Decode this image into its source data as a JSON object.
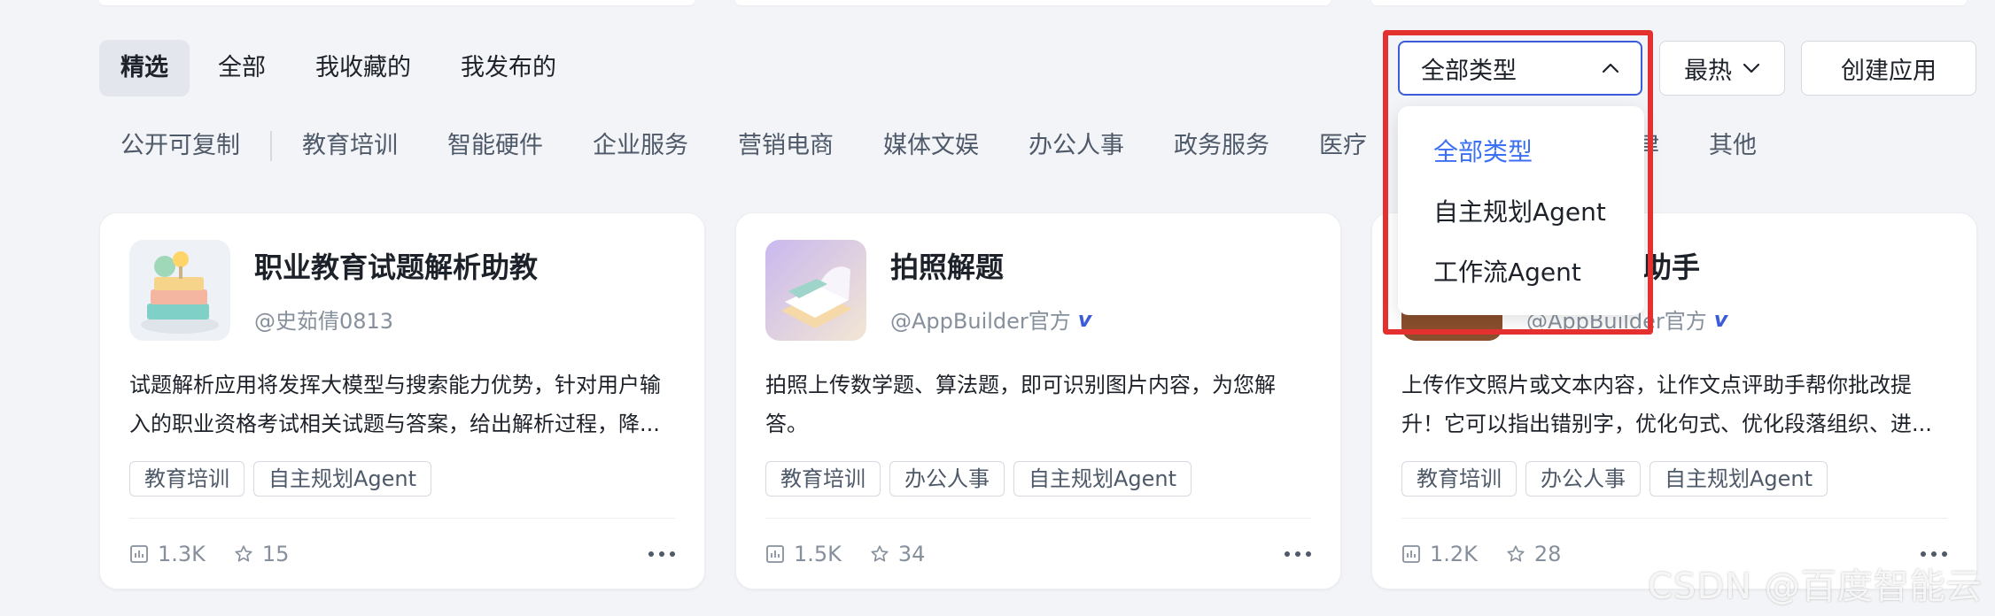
{
  "tabs": [
    {
      "label": "精选",
      "active": true
    },
    {
      "label": "全部"
    },
    {
      "label": "我收藏的"
    },
    {
      "label": "我发布的"
    }
  ],
  "filters": {
    "type_select": {
      "value": "全部类型",
      "open": true
    },
    "sort": {
      "label": "最热"
    },
    "create_button": "创建应用"
  },
  "dropdown": {
    "options": [
      {
        "label": "全部类型",
        "selected": true
      },
      {
        "label": "自主规划Agent"
      },
      {
        "label": "工作流Agent"
      }
    ]
  },
  "categories": [
    "公开可复制",
    "教育培训",
    "智能硬件",
    "企业服务",
    "营销电商",
    "媒体文娱",
    "办公人事",
    "政务服务",
    "医疗",
    "法律",
    "其他"
  ],
  "cards": [
    {
      "title": "职业教育试题解析助教",
      "author": "@史茹倩0813",
      "verified": false,
      "desc_line1": "试题解析应用将发挥大模型与搜索能力优势，针对用户输",
      "desc_line2": "入的职业资格考试相关试题与答案，给出解析过程，降...",
      "tags": [
        "教育培训",
        "自主规划Agent"
      ],
      "views": "1.3K",
      "stars": "15"
    },
    {
      "title": "拍照解题",
      "author": "@AppBuilder官方",
      "verified": true,
      "desc_line1": "拍照上传数学题、算法题，即可识别图片内容，为您解",
      "desc_line2": "答。",
      "tags": [
        "教育培训",
        "办公人事",
        "自主规划Agent"
      ],
      "views": "1.5K",
      "stars": "34"
    },
    {
      "title": "助手",
      "author": "@AppBuilder官方",
      "verified": true,
      "desc_line1": "上传作文照片或文本内容，让作文点评助手帮你批改提",
      "desc_line2": "升！它可以指出错别字，优化句式、优化段落组织、进...",
      "tags": [
        "教育培训",
        "办公人事",
        "自主规划Agent"
      ],
      "views": "1.2K",
      "stars": "28"
    }
  ],
  "verified_mark": "v",
  "watermark": "CSDN @百度智能云",
  "colors": {
    "accent": "#3b6ff5",
    "highlight": "#e53030"
  }
}
